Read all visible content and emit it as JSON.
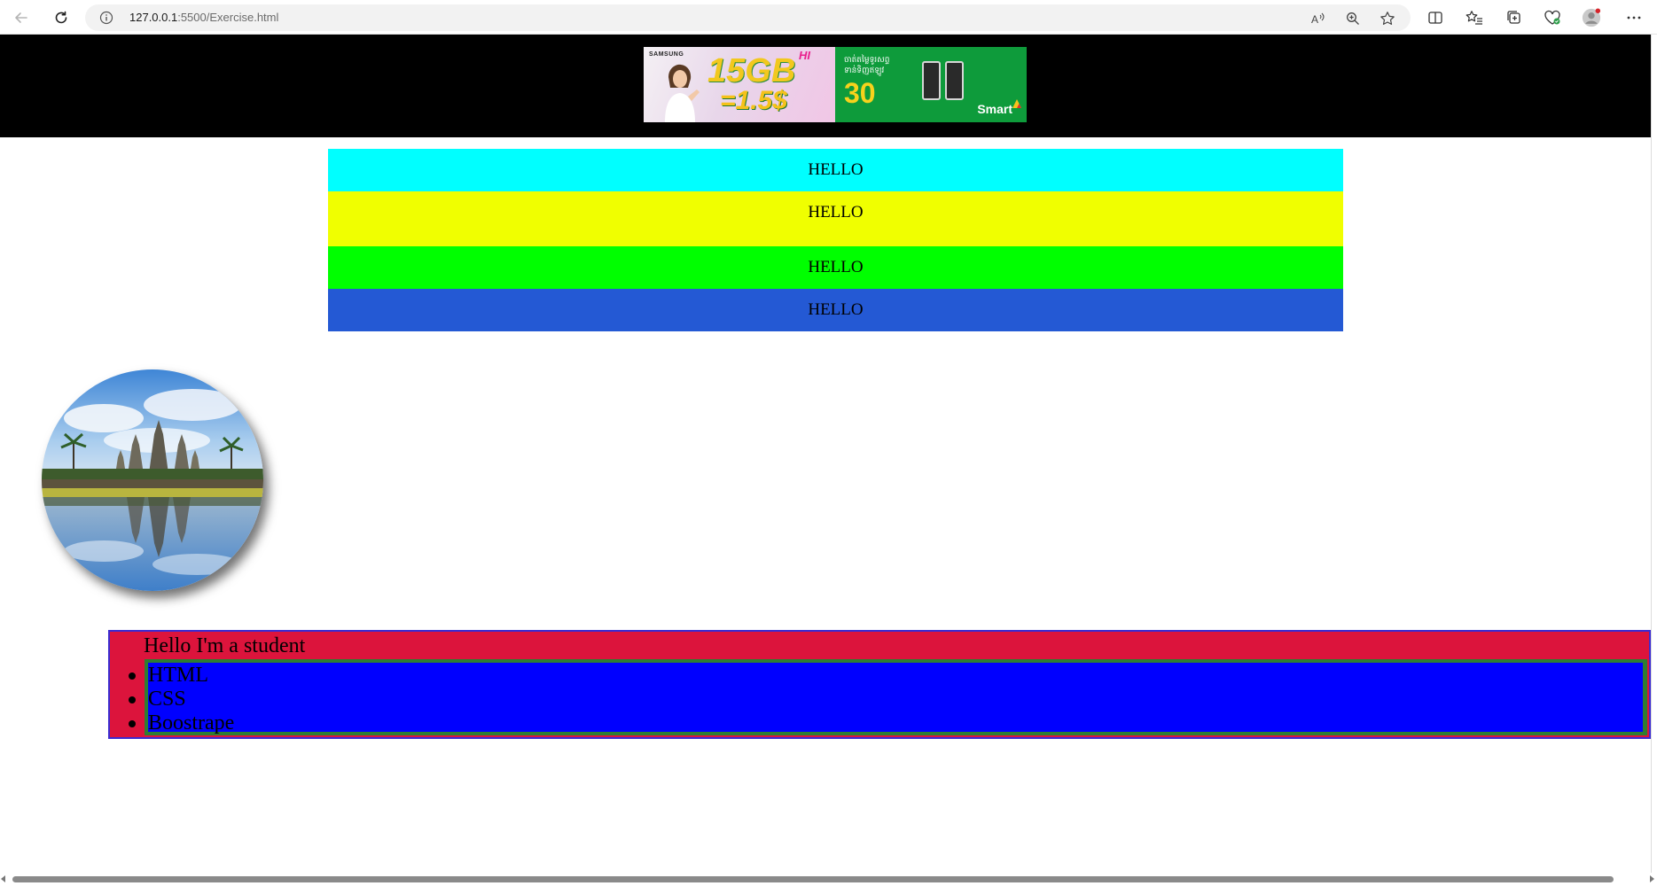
{
  "browser": {
    "url_host": "127.0.0.1",
    "url_path": ":5500/Exercise.html",
    "icons": [
      "back-icon",
      "reload-icon",
      "site-info-icon",
      "read-aloud-icon",
      "zoom-icon",
      "favorite-star-icon",
      "split-screen-icon",
      "favorites-icon",
      "collections-icon",
      "browser-essentials-icon",
      "profile-icon",
      "more-menu-icon"
    ]
  },
  "banner": {
    "brand": "SAMSUNG",
    "hi_label": "HI",
    "data_offer": "15GB",
    "price_offer": "=1.5$",
    "khmer_text": "ចាត់តម្លៃទូរសព្ទ ទាន់ទិញឥឡូវ",
    "days_offer": "30",
    "carrier": "Smart"
  },
  "hello_boxes": [
    {
      "text": "HELLO",
      "color": "#00ffff"
    },
    {
      "text": "HELLO",
      "color": "#f0ff00"
    },
    {
      "text": "HELLO",
      "color": "#00ff00"
    },
    {
      "text": "HELLO",
      "color": "#2459d4"
    }
  ],
  "student": {
    "heading": "Hello I'm a student",
    "skills": [
      "HTML",
      "CSS",
      "Boostrape"
    ],
    "box_color": "#dc143c",
    "list_color": "#0000ff"
  }
}
